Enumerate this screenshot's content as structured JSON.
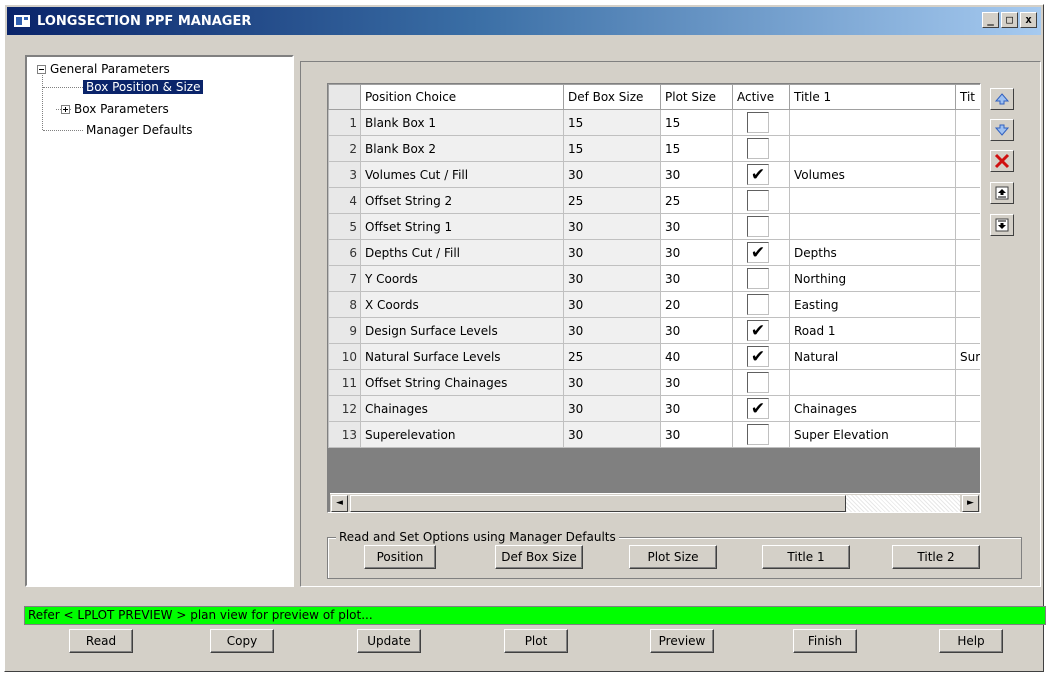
{
  "window": {
    "title": "LONGSECTION PPF MANAGER",
    "controls": [
      "_",
      "□",
      "x"
    ]
  },
  "tree": {
    "root": "General Parameters",
    "items": [
      {
        "label": "Box Position & Size",
        "selected": true
      },
      {
        "label": "Box Parameters",
        "expandable": true
      },
      {
        "label": "Manager Defaults"
      }
    ]
  },
  "grid": {
    "columns": [
      "Position Choice",
      "Def Box Size",
      "Plot Size",
      "Active",
      "Title 1",
      "Tit"
    ],
    "rows": [
      {
        "num": "1",
        "position": "Blank Box 1",
        "def": "15",
        "plot": "15",
        "active": "",
        "title1": "",
        "title2": ""
      },
      {
        "num": "2",
        "position": "Blank Box 2",
        "def": "15",
        "plot": "15",
        "active": "",
        "title1": "",
        "title2": ""
      },
      {
        "num": "3",
        "position": "Volumes Cut / Fill",
        "def": "30",
        "plot": "30",
        "active": "✔",
        "title1": "Volumes",
        "title2": ""
      },
      {
        "num": "4",
        "position": "Offset String 2",
        "def": "25",
        "plot": "25",
        "active": "",
        "title1": "",
        "title2": ""
      },
      {
        "num": "5",
        "position": "Offset String 1",
        "def": "30",
        "plot": "30",
        "active": "",
        "title1": "",
        "title2": ""
      },
      {
        "num": "6",
        "position": "Depths Cut / Fill",
        "def": "30",
        "plot": "30",
        "active": "✔",
        "title1": "Depths",
        "title2": ""
      },
      {
        "num": "7",
        "position": "Y Coords",
        "def": "30",
        "plot": "30",
        "active": "",
        "title1": "Northing",
        "title2": ""
      },
      {
        "num": "8",
        "position": "X Coords",
        "def": "30",
        "plot": "20",
        "active": "",
        "title1": "Easting",
        "title2": ""
      },
      {
        "num": "9",
        "position": "Design Surface Levels",
        "def": "30",
        "plot": "30",
        "active": "✔",
        "title1": "Road 1",
        "title2": ""
      },
      {
        "num": "10",
        "position": "Natural Surface Levels",
        "def": "25",
        "plot": "40",
        "active": "✔",
        "title1": "Natural",
        "title2": "Sur"
      },
      {
        "num": "11",
        "position": "Offset String Chainages",
        "def": "30",
        "plot": "30",
        "active": "",
        "title1": "",
        "title2": ""
      },
      {
        "num": "12",
        "position": "Chainages",
        "def": "30",
        "plot": "30",
        "active": "✔",
        "title1": "Chainages",
        "title2": ""
      },
      {
        "num": "13",
        "position": "Superelevation",
        "def": "30",
        "plot": "30",
        "active": "",
        "title1": "Super Elevation",
        "title2": ""
      }
    ]
  },
  "scroll": {
    "left": "◄",
    "right": "►"
  },
  "side_buttons": [
    "move-up-icon",
    "move-down-icon",
    "delete-icon",
    "insert-above-icon",
    "insert-below-icon"
  ],
  "defaults_group": {
    "legend": "Read and Set Options using Manager Defaults",
    "buttons": [
      "Position",
      "Def Box Size",
      "Plot Size",
      "Title 1",
      "Title 2"
    ]
  },
  "status": "Refer < LPLOT PREVIEW > plan view for preview of plot...",
  "bottom_buttons": [
    "Read",
    "Copy",
    "Update",
    "Plot",
    "Preview",
    "Finish",
    "Help"
  ],
  "colors": {
    "status_bg": "#00ff00",
    "selection": "#0a246a",
    "delete": "#d01010",
    "arrow": "#3060c0"
  }
}
